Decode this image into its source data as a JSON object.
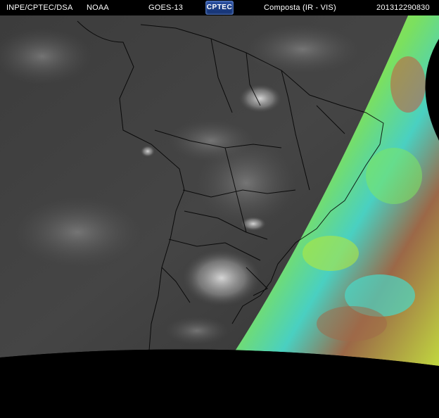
{
  "header": {
    "agency": "INPE/CPTEC/DSA",
    "source": "NOAA",
    "satellite": "GOES-13",
    "logo_text": "CPTEC",
    "product": "Composta (IR - VIS)",
    "timestamp": "201312290830"
  },
  "colors": {
    "background": "#000000",
    "header_text": "#ffffff",
    "ir_base": "#3a3a3a",
    "border_lines": "#000000",
    "vis_palette": [
      "#b0e840",
      "#7ee860",
      "#4ad8c8",
      "#d04a3a",
      "#a06a48",
      "#c8e040"
    ]
  }
}
